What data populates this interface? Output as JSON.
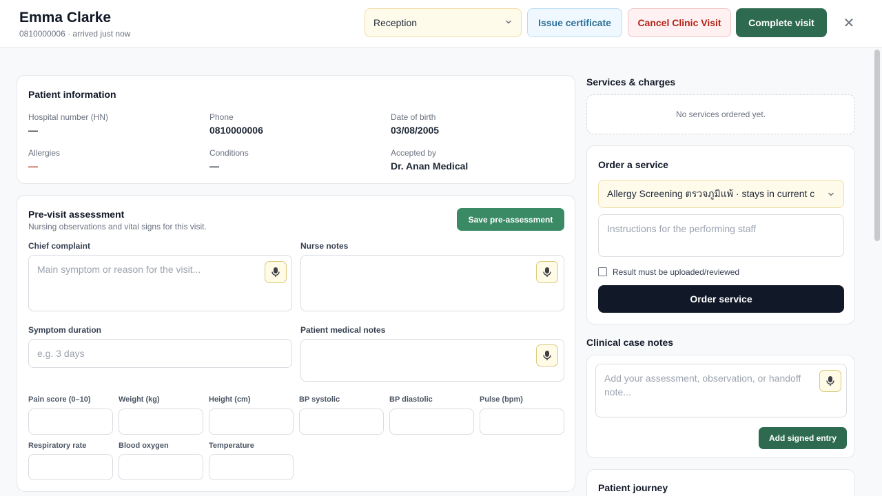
{
  "header": {
    "patient_name": "Emma Clarke",
    "patient_sub": "0810000006 · arrived just now",
    "stage_select": "Reception",
    "issue_certificate": "Issue certificate",
    "cancel_visit": "Cancel Clinic Visit",
    "complete_visit": "Complete visit",
    "close_glyph": "✕"
  },
  "patient_info": {
    "title": "Patient information",
    "fields": [
      {
        "label": "Hospital number (HN)",
        "value": "—"
      },
      {
        "label": "Phone",
        "value": "0810000006"
      },
      {
        "label": "Date of birth",
        "value": "03/08/2005"
      },
      {
        "label": "Allergies",
        "value": "—"
      },
      {
        "label": "Conditions",
        "value": "—"
      },
      {
        "label": "Accepted by",
        "value": "Dr. Anan Medical"
      }
    ]
  },
  "pre_visit": {
    "title": "Pre-visit assessment",
    "subtitle": "Nursing observations and vital signs for this visit.",
    "save_button": "Save pre-assessment",
    "chief_complaint": {
      "label": "Chief complaint",
      "placeholder": "Main symptom or reason for the visit..."
    },
    "nurse_notes": {
      "label": "Nurse notes",
      "placeholder": ""
    },
    "symptom_duration": {
      "label": "Symptom duration",
      "placeholder": "e.g. 3 days"
    },
    "patient_medical_notes": {
      "label": "Patient medical notes",
      "placeholder": ""
    },
    "vitals": [
      "Pain score (0–10)",
      "Weight (kg)",
      "Height (cm)",
      "BP systolic",
      "BP diastolic",
      "Pulse (bpm)",
      "Respiratory rate",
      "Blood oxygen",
      "Temperature"
    ]
  },
  "services": {
    "title": "Services & charges",
    "empty_text": "No services ordered yet."
  },
  "order": {
    "title": "Order a service",
    "selected_service": "Allergy Screening ตรวจภูมิแพ้ · stays in current c",
    "instructions_placeholder": "Instructions for the performing staff",
    "checkbox_label": "Result must be uploaded/reviewed",
    "order_button": "Order service"
  },
  "case_notes": {
    "title": "Clinical case notes",
    "placeholder": "Add your assessment, observation, or handoff note...",
    "add_button": "Add signed entry"
  },
  "journey": {
    "title": "Patient journey"
  },
  "colors": {
    "primary_green": "#2e6a4f",
    "save_green": "#3a8a65",
    "cancel_red": "#b42318",
    "cert_blue": "#2d6f95",
    "select_yellow": "#fffbeb",
    "dark_button": "#111827"
  },
  "icons": {
    "mic": "microphone-icon",
    "chevron": "chevron-down-icon",
    "close": "close-icon"
  }
}
